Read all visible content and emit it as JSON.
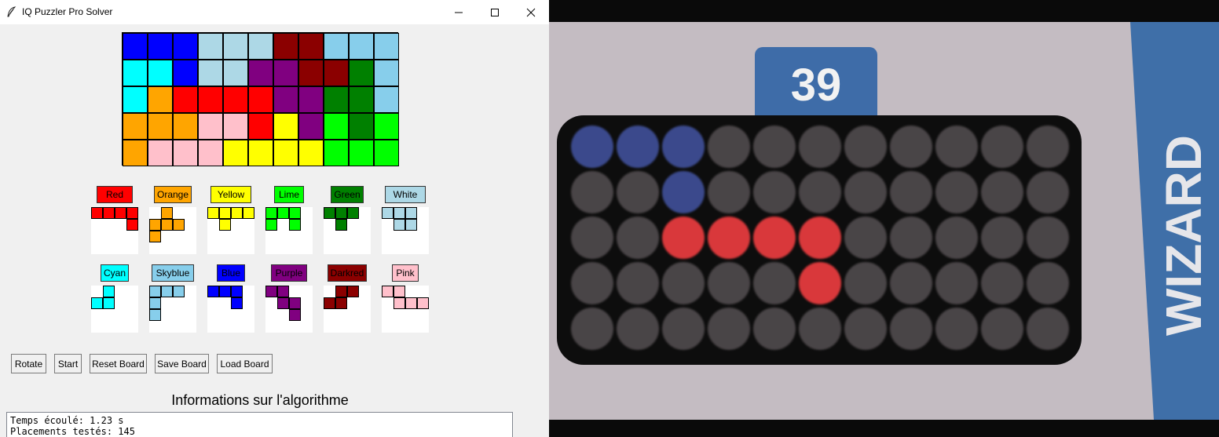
{
  "window": {
    "title": "IQ Puzzler Pro Solver",
    "controls": [
      "minimize",
      "maximize",
      "close"
    ]
  },
  "colors": {
    "blue": "#0000ff",
    "lightblue": "#add8e6",
    "darkred": "#8b0000",
    "skyblue": "#87ceeb",
    "cyan": "#00ffff",
    "purple": "#800080",
    "green": "#008000",
    "orange": "#ffa500",
    "red": "#ff0000",
    "pink": "#ffc0cb",
    "yellow": "#ffff00",
    "lime": "#00ff00"
  },
  "board": {
    "rows": [
      [
        "blue",
        "blue",
        "blue",
        "lightblue",
        "lightblue",
        "lightblue",
        "darkred",
        "darkred",
        "skyblue",
        "skyblue",
        "skyblue"
      ],
      [
        "cyan",
        "cyan",
        "blue",
        "lightblue",
        "lightblue",
        "purple",
        "purple",
        "darkred",
        "darkred",
        "green",
        "skyblue"
      ],
      [
        "cyan",
        "orange",
        "red",
        "red",
        "red",
        "red",
        "purple",
        "purple",
        "green",
        "green",
        "skyblue"
      ],
      [
        "orange",
        "orange",
        "orange",
        "pink",
        "pink",
        "red",
        "yellow",
        "purple",
        "lime",
        "green",
        "lime"
      ],
      [
        "orange",
        "pink",
        "pink",
        "pink",
        "yellow",
        "yellow",
        "yellow",
        "yellow",
        "lime",
        "lime",
        "lime"
      ]
    ]
  },
  "pieces": [
    {
      "label": "Red",
      "color": "#ff0000",
      "cells": [
        [
          0,
          0
        ],
        [
          0,
          1
        ],
        [
          0,
          2
        ],
        [
          0,
          3
        ],
        [
          1,
          3
        ]
      ]
    },
    {
      "label": "Orange",
      "color": "#ffa500",
      "cells": [
        [
          0,
          1
        ],
        [
          1,
          0
        ],
        [
          1,
          1
        ],
        [
          1,
          2
        ],
        [
          2,
          0
        ]
      ]
    },
    {
      "label": "Yellow",
      "color": "#ffff00",
      "cells": [
        [
          0,
          0
        ],
        [
          0,
          1
        ],
        [
          0,
          2
        ],
        [
          0,
          3
        ],
        [
          1,
          1
        ]
      ]
    },
    {
      "label": "Lime",
      "color": "#00ff00",
      "cells": [
        [
          0,
          0
        ],
        [
          0,
          1
        ],
        [
          0,
          2
        ],
        [
          1,
          0
        ],
        [
          1,
          2
        ]
      ]
    },
    {
      "label": "Green",
      "color": "#008000",
      "cells": [
        [
          0,
          0
        ],
        [
          0,
          1
        ],
        [
          0,
          2
        ],
        [
          1,
          1
        ]
      ]
    },
    {
      "label": "White",
      "color": "#add8e6",
      "cells": [
        [
          0,
          0
        ],
        [
          0,
          1
        ],
        [
          0,
          2
        ],
        [
          1,
          1
        ],
        [
          1,
          2
        ]
      ]
    },
    {
      "label": "Cyan",
      "color": "#00ffff",
      "cells": [
        [
          0,
          1
        ],
        [
          1,
          0
        ],
        [
          1,
          1
        ]
      ]
    },
    {
      "label": "Skyblue",
      "color": "#87ceeb",
      "cells": [
        [
          0,
          0
        ],
        [
          0,
          1
        ],
        [
          0,
          2
        ],
        [
          1,
          0
        ],
        [
          2,
          0
        ]
      ]
    },
    {
      "label": "Blue",
      "color": "#0000ff",
      "cells": [
        [
          0,
          0
        ],
        [
          0,
          1
        ],
        [
          0,
          2
        ],
        [
          1,
          2
        ]
      ]
    },
    {
      "label": "Purple",
      "color": "#800080",
      "cells": [
        [
          0,
          0
        ],
        [
          0,
          1
        ],
        [
          1,
          1
        ],
        [
          1,
          2
        ],
        [
          2,
          2
        ]
      ]
    },
    {
      "label": "Darkred",
      "color": "#8b0000",
      "cells": [
        [
          0,
          1
        ],
        [
          0,
          2
        ],
        [
          1,
          0
        ],
        [
          1,
          1
        ]
      ]
    },
    {
      "label": "Pink",
      "color": "#ffc0cb",
      "cells": [
        [
          0,
          0
        ],
        [
          0,
          1
        ],
        [
          1,
          1
        ],
        [
          1,
          2
        ],
        [
          1,
          3
        ]
      ]
    }
  ],
  "toolbar": {
    "rotate": "Rotate",
    "start": "Start",
    "reset": "Reset Board",
    "save": "Save Board",
    "load": "Load Board"
  },
  "info": {
    "title": "Informations sur l'algorithme",
    "lines": [
      "Temps écoulé: 1.23 s",
      "Placements testés: 145"
    ]
  },
  "camera": {
    "level": "39",
    "brand": "WIZARD",
    "grid_rows": 5,
    "grid_cols": 11,
    "pegs": [
      {
        "color": "#3a4a8c",
        "cells": [
          [
            0,
            0
          ],
          [
            0,
            1
          ],
          [
            0,
            2
          ],
          [
            1,
            2
          ]
        ]
      },
      {
        "color": "#d9373a",
        "cells": [
          [
            2,
            2
          ],
          [
            2,
            3
          ],
          [
            2,
            4
          ],
          [
            2,
            5
          ],
          [
            3,
            5
          ]
        ]
      }
    ]
  }
}
